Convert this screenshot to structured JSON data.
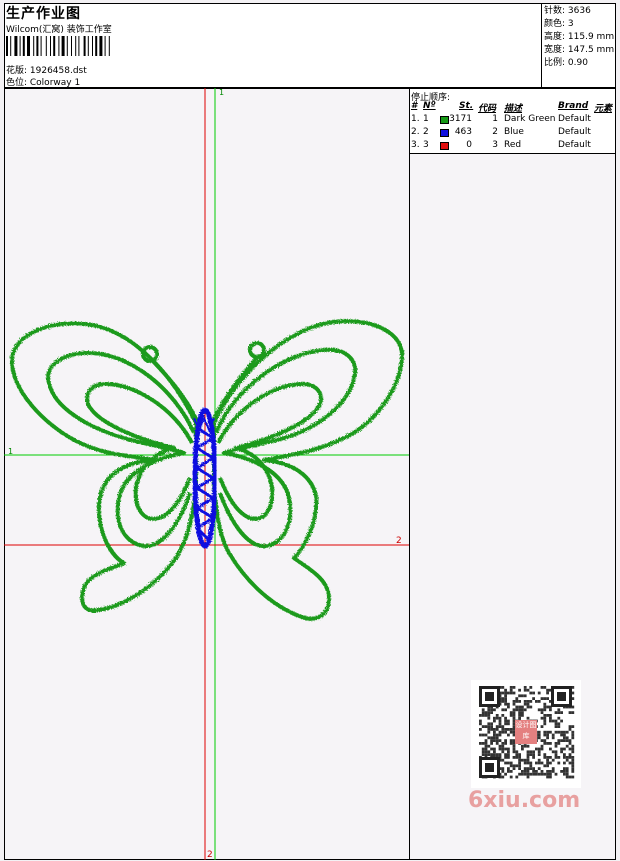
{
  "header": {
    "title": "生产作业图",
    "company": "Wilcom(汇窝) 装饰工作室",
    "design": "花版: 1926458.dst",
    "colorway": "色位: Colorway 1"
  },
  "stats": [
    {
      "label": "针数:",
      "value": "3636"
    },
    {
      "label": "颜色:",
      "value": "3"
    },
    {
      "label": "高度:",
      "value": "115.9 mm"
    },
    {
      "label": "宽度:",
      "value": "147.5 mm"
    },
    {
      "label": "比例:",
      "value": "0.90"
    }
  ],
  "stop_sequence": {
    "title": "停止顺序:",
    "headers": {
      "num": "#",
      "n": "Nº",
      "st": "St.",
      "code": "代码",
      "desc": "描述",
      "brand": "Brand",
      "element": "元素"
    },
    "rows": [
      {
        "num": "1.",
        "n": "1",
        "color": "#169a16",
        "st": "3171",
        "code": "1",
        "desc": "Dark Green",
        "brand": "Default"
      },
      {
        "num": "2.",
        "n": "2",
        "color": "#1010e0",
        "st": "463",
        "code": "2",
        "desc": "Blue",
        "brand": "Default"
      },
      {
        "num": "3.",
        "n": "3",
        "color": "#e01010",
        "st": "0",
        "code": "3",
        "desc": "Red",
        "brand": "Default"
      }
    ]
  },
  "axis_labels": {
    "green_top": "1",
    "green_left": "1",
    "red_right": "2",
    "red_bottom": "2"
  },
  "watermark": "6xiu.com",
  "qr_badge": "设计图库"
}
